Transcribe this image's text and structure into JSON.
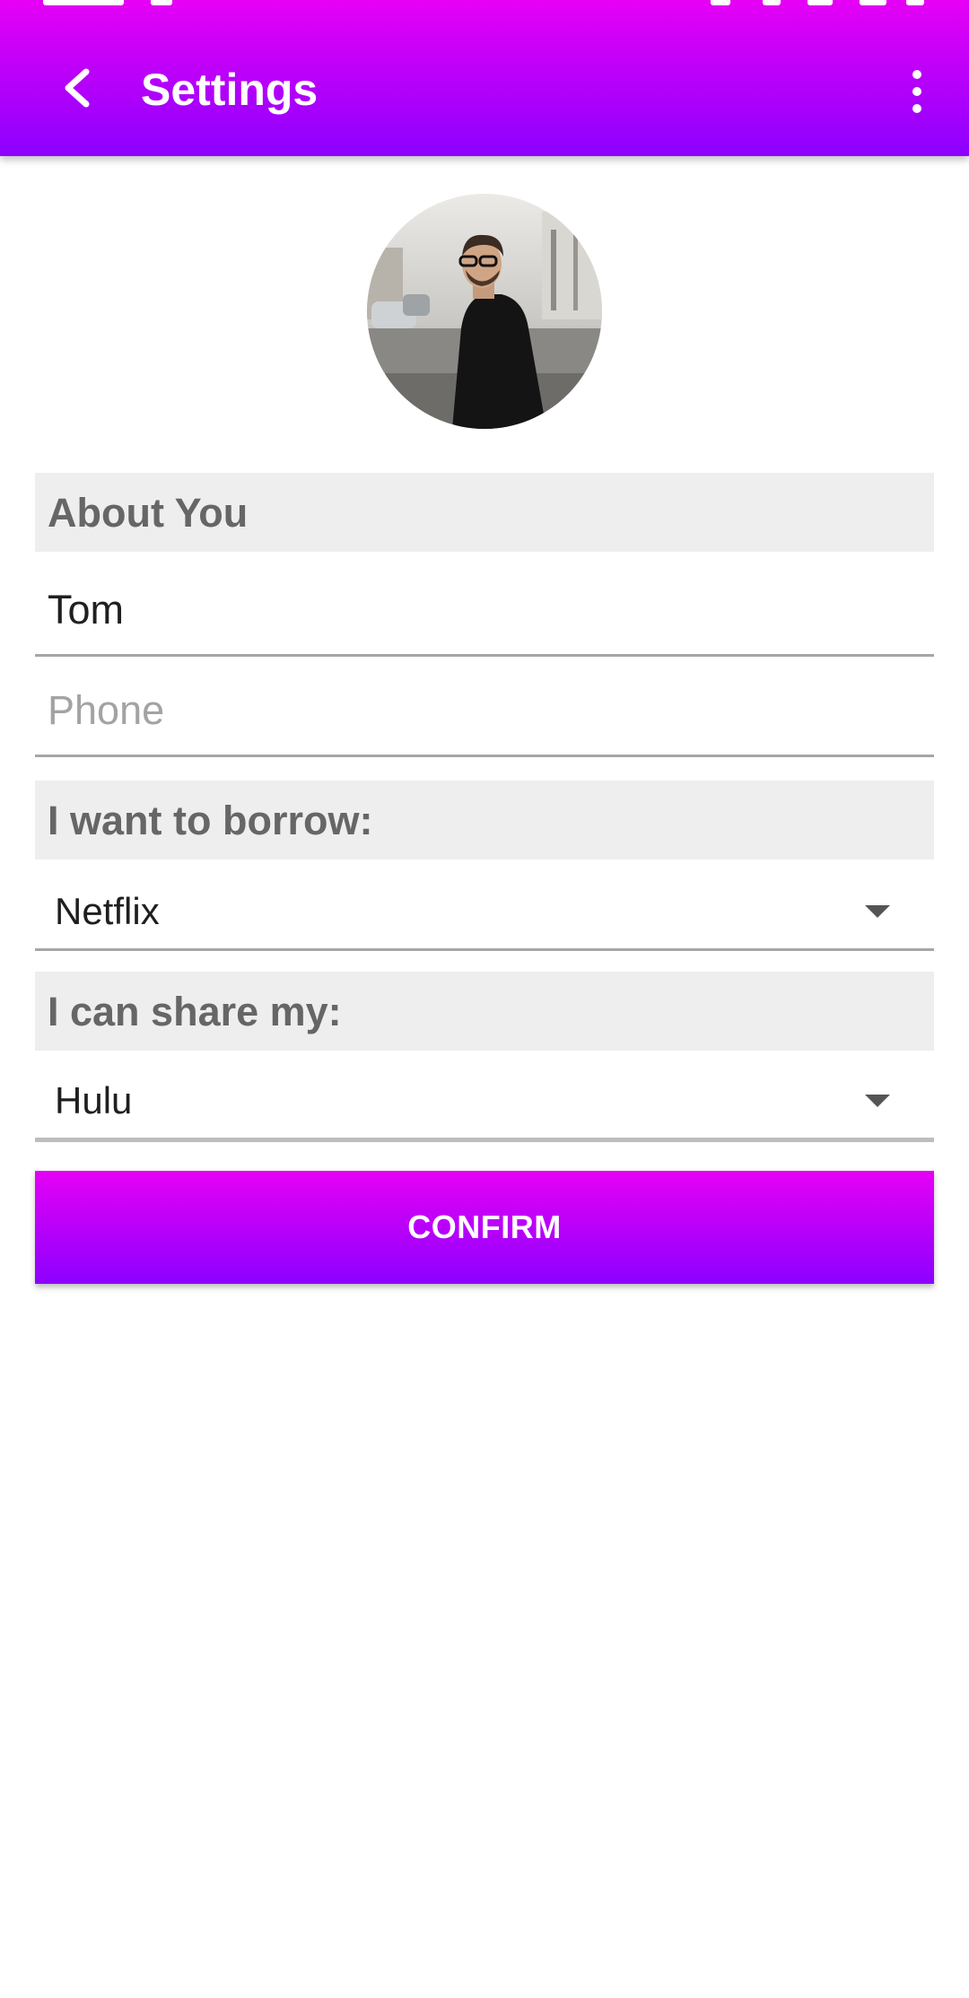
{
  "header": {
    "title": "Settings",
    "back_icon": "chevron-left-icon",
    "more_icon": "more-vertical-icon"
  },
  "profile": {
    "avatar": "profile-photo"
  },
  "about": {
    "heading": "About You",
    "name_value": "Tom",
    "phone_placeholder": "Phone"
  },
  "borrow": {
    "heading": "I want to borrow:",
    "selected": "Netflix"
  },
  "share": {
    "heading": "I can share my:",
    "selected": "Hulu"
  },
  "actions": {
    "confirm_label": "CONFIRM"
  },
  "colors": {
    "accent_top": "#e600f5",
    "accent_bottom": "#8c00ff",
    "section_bg": "#eeeeee",
    "section_text": "#666666"
  }
}
